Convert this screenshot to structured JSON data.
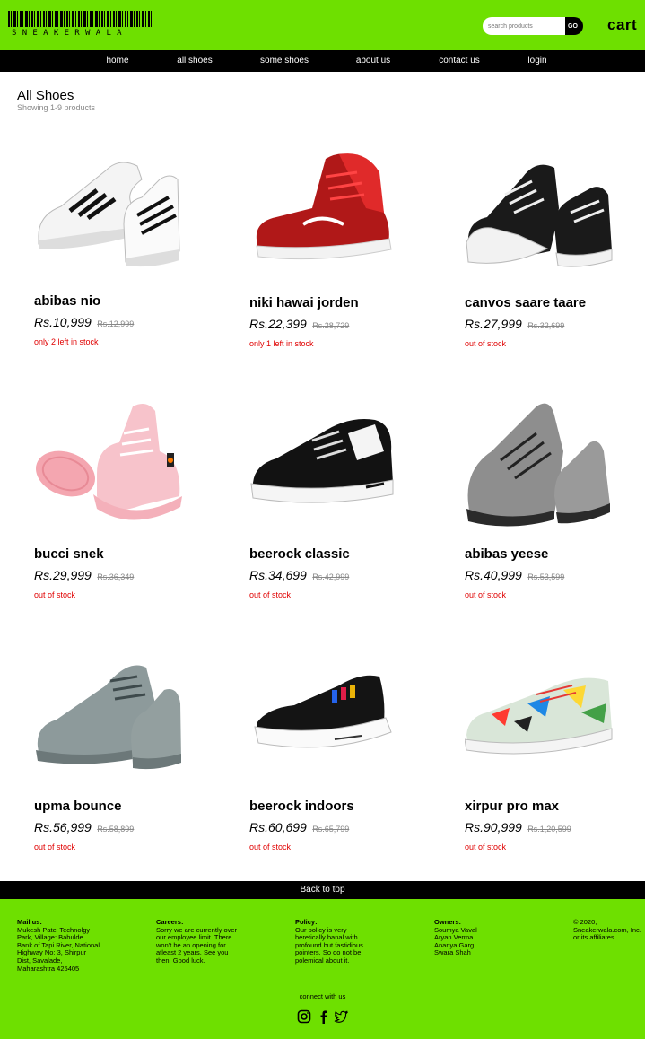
{
  "header": {
    "logo_text": "SNEAKERWALA",
    "search_placeholder": "search products",
    "search_button": "GO",
    "cart_label": "cart"
  },
  "nav": {
    "items": [
      {
        "label": "home"
      },
      {
        "label": "all shoes"
      },
      {
        "label": "some shoes"
      },
      {
        "label": "about us"
      },
      {
        "label": "contact us"
      },
      {
        "label": "login"
      }
    ]
  },
  "page": {
    "title": "All Shoes",
    "subtitle": "Showing 1-9 products"
  },
  "products": [
    {
      "name": "abibas nio",
      "price": "Rs.10,999",
      "mrp": "Rs.12,999",
      "stock": "only 2 left in stock",
      "image": "white-sneaker-black-stripes"
    },
    {
      "name": "niki hawai jorden",
      "price": "Rs.22,399",
      "mrp": "Rs.28,729",
      "stock": "only 1 left in stock",
      "image": "red-high-top-sneaker"
    },
    {
      "name": "canvos saare taare",
      "price": "Rs.27,999",
      "mrp": "Rs.32,699",
      "stock": "out of stock",
      "image": "black-canvas-sneaker"
    },
    {
      "name": "bucci snek",
      "price": "Rs.29,999",
      "mrp": "Rs.36,349",
      "stock": "out of stock",
      "image": "pink-sneaker"
    },
    {
      "name": "beerock classic",
      "price": "Rs.34,699",
      "mrp": "Rs.42,999",
      "stock": "out of stock",
      "image": "black-white-running-shoe"
    },
    {
      "name": "abibas yeese",
      "price": "Rs.40,999",
      "mrp": "Rs.53,599",
      "stock": "out of stock",
      "image": "grey-knit-sneaker"
    },
    {
      "name": "upma bounce",
      "price": "Rs.56,999",
      "mrp": "Rs.58,899",
      "stock": "out of stock",
      "image": "grey-sneaker"
    },
    {
      "name": "beerock indoors",
      "price": "Rs.60,699",
      "mrp": "Rs.65,799",
      "stock": "out of stock",
      "image": "black-white-slip-on-shoe"
    },
    {
      "name": "xirpur pro max",
      "price": "Rs.90,999",
      "mrp": "Rs.1,20,599",
      "stock": "out of stock",
      "image": "graffiti-print-sneaker"
    }
  ],
  "back_to_top": "Back to top",
  "footer": {
    "mail": {
      "heading": "Mail us:",
      "text": "Mukesh Patel Technolgy Park, Village: Babulde Bank of Tapi River, National Highway No: 3, Shirpur Dist, Savalade, Maharashtra 425405"
    },
    "careers": {
      "heading": "Careers:",
      "text": "Sorry we are currently over our employee limit. There won't be an opening for atleast 2 years. See you then. Good luck."
    },
    "policy": {
      "heading": "Policy:",
      "text": "Our policy is very heretically banal with profound but fastidious pointers. So do not be polemical about it."
    },
    "owners": {
      "heading": "Owners:",
      "names": [
        "Soumya Vaval",
        "Aryan Verma",
        "Ananya Garg",
        "Swara Shah"
      ]
    },
    "copyright": "© 2020, Sneakerwala.com, Inc. or its affiliates",
    "connect": "connect with us",
    "social": [
      "instagram-icon",
      "facebook-icon",
      "twitter-icon"
    ]
  },
  "colors": {
    "brand_green": "#6ee000",
    "nav_black": "#000000",
    "stock_red": "#e00000"
  }
}
